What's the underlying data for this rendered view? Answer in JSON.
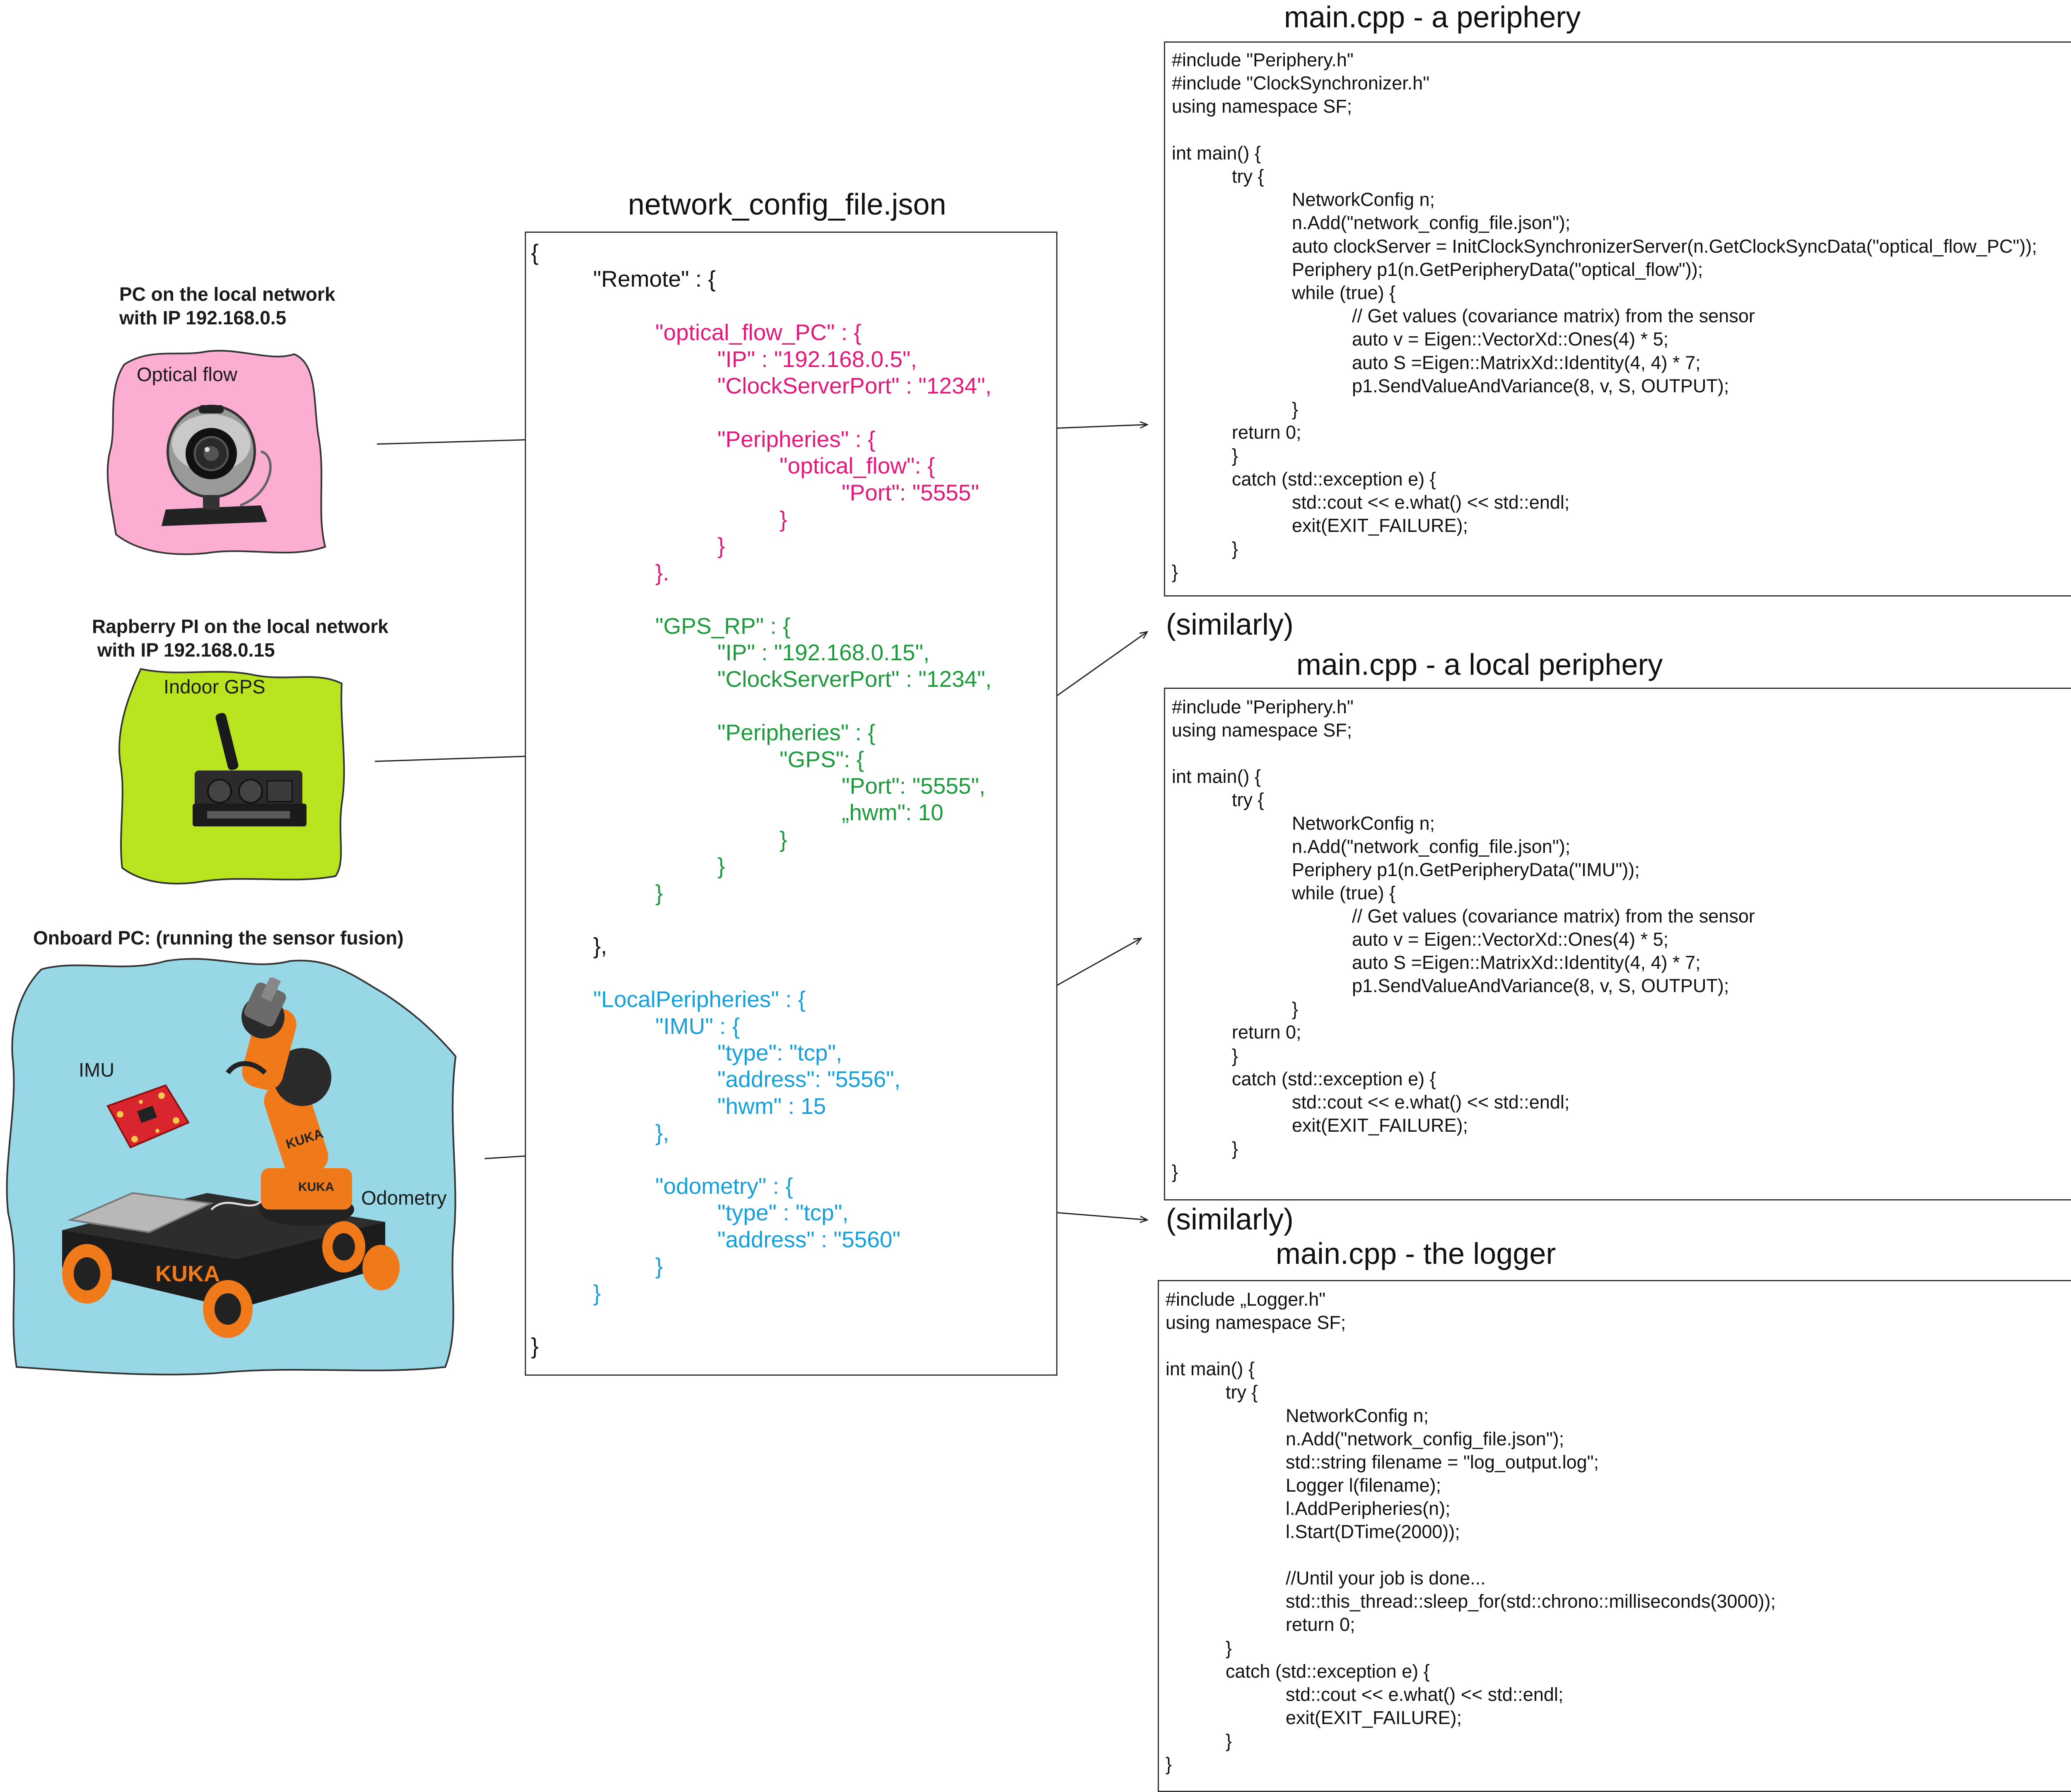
{
  "colors": {
    "pc_blob": "#fbaed2",
    "rpi_blob": "#b9e420",
    "onboard_blob": "#98d8e6",
    "json_remote": "#111111",
    "json_optical": "#e2197a",
    "json_gps": "#1d9a3c",
    "json_local": "#16a0da",
    "border": "#333333"
  },
  "nodes": [
    {
      "title_lines": [
        "PC on the local network",
        "with IP 192.168.0.5"
      ],
      "devices": [
        {
          "label": "Optical flow",
          "icon": "webcam-icon"
        }
      ]
    },
    {
      "title_lines": [
        "Rapberry PI on the local network",
        " with IP 192.168.0.15"
      ],
      "devices": [
        {
          "label": "Indoor GPS",
          "icon": "indoor-gps-beacon-icon"
        }
      ]
    },
    {
      "title_lines": [
        "Onboard PC: (running the sensor fusion)"
      ],
      "devices": [
        {
          "label": "IMU",
          "icon": "imu-board-icon"
        },
        {
          "label": "Odometry",
          "icon": "kuka-mobile-robot-icon"
        }
      ]
    }
  ],
  "json_file": {
    "title": "network_config_file.json",
    "lines": [
      {
        "indent": 0,
        "color": "json_remote",
        "text": "{"
      },
      {
        "indent": 1,
        "color": "json_remote",
        "text": "\"Remote\" : {"
      },
      {
        "indent": 0,
        "color": "json_remote",
        "text": ""
      },
      {
        "indent": 2,
        "color": "json_optical",
        "text": "\"optical_flow_PC\" : {"
      },
      {
        "indent": 3,
        "color": "json_optical",
        "text": "\"IP\" : \"192.168.0.5\","
      },
      {
        "indent": 3,
        "color": "json_optical",
        "text": "\"ClockServerPort\" : \"1234\","
      },
      {
        "indent": 0,
        "color": "json_optical",
        "text": ""
      },
      {
        "indent": 3,
        "color": "json_optical",
        "text": "\"Peripheries\" : {"
      },
      {
        "indent": 4,
        "color": "json_optical",
        "text": "\"optical_flow\": {"
      },
      {
        "indent": 5,
        "color": "json_optical",
        "text": "\"Port\": \"5555\""
      },
      {
        "indent": 4,
        "color": "json_optical",
        "text": "}"
      },
      {
        "indent": 3,
        "color": "json_optical",
        "text": "}"
      },
      {
        "indent": 2,
        "color": "json_optical",
        "text": "}."
      },
      {
        "indent": 0,
        "color": "json_gps",
        "text": ""
      },
      {
        "indent": 2,
        "color": "json_gps",
        "text": "\"GPS_RP\" : {"
      },
      {
        "indent": 3,
        "color": "json_gps",
        "text": "\"IP\" : \"192.168.0.15\","
      },
      {
        "indent": 3,
        "color": "json_gps",
        "text": "\"ClockServerPort\" : \"1234\","
      },
      {
        "indent": 0,
        "color": "json_gps",
        "text": ""
      },
      {
        "indent": 3,
        "color": "json_gps",
        "text": "\"Peripheries\" : {"
      },
      {
        "indent": 4,
        "color": "json_gps",
        "text": "\"GPS\": {"
      },
      {
        "indent": 5,
        "color": "json_gps",
        "text": "\"Port\": \"5555\","
      },
      {
        "indent": 5,
        "color": "json_gps",
        "text": "„hwm\": 10"
      },
      {
        "indent": 4,
        "color": "json_gps",
        "text": "}"
      },
      {
        "indent": 3,
        "color": "json_gps",
        "text": "}"
      },
      {
        "indent": 2,
        "color": "json_gps",
        "text": "}"
      },
      {
        "indent": 0,
        "color": "json_remote",
        "text": ""
      },
      {
        "indent": 1,
        "color": "json_remote",
        "text": "},"
      },
      {
        "indent": 0,
        "color": "json_remote",
        "text": ""
      },
      {
        "indent": 1,
        "color": "json_local",
        "text": "\"LocalPeripheries\" : {"
      },
      {
        "indent": 2,
        "color": "json_local",
        "text": "\"IMU\" : {"
      },
      {
        "indent": 3,
        "color": "json_local",
        "text": "\"type\": \"tcp\","
      },
      {
        "indent": 3,
        "color": "json_local",
        "text": "\"address\": \"5556\","
      },
      {
        "indent": 3,
        "color": "json_local",
        "text": "\"hwm\" : 15"
      },
      {
        "indent": 2,
        "color": "json_local",
        "text": "},"
      },
      {
        "indent": 0,
        "color": "json_local",
        "text": ""
      },
      {
        "indent": 2,
        "color": "json_local",
        "text": "\"odometry\" : {"
      },
      {
        "indent": 3,
        "color": "json_local",
        "text": "\"type\" : \"tcp\","
      },
      {
        "indent": 3,
        "color": "json_local",
        "text": "\"address\" : \"5560\""
      },
      {
        "indent": 2,
        "color": "json_local",
        "text": "}"
      },
      {
        "indent": 1,
        "color": "json_local",
        "text": "}"
      },
      {
        "indent": 0,
        "color": "json_remote",
        "text": ""
      },
      {
        "indent": 0,
        "color": "json_remote",
        "text": "}"
      }
    ]
  },
  "code_files": [
    {
      "title": "main.cpp - a periphery",
      "lines": [
        {
          "indent": 0,
          "text": "#include \"Periphery.h\""
        },
        {
          "indent": 0,
          "text": "#include \"ClockSynchronizer.h\""
        },
        {
          "indent": 0,
          "text": "using namespace SF;"
        },
        {
          "indent": 0,
          "text": ""
        },
        {
          "indent": 0,
          "text": "int main() {"
        },
        {
          "indent": 1,
          "text": "try {"
        },
        {
          "indent": 2,
          "text": "NetworkConfig n;"
        },
        {
          "indent": 2,
          "text": "n.Add(\"network_config_file.json\");"
        },
        {
          "indent": 2,
          "text": "auto clockServer = InitClockSynchronizerServer(n.GetClockSyncData(\"optical_flow_PC\"));"
        },
        {
          "indent": 2,
          "text": "Periphery p1(n.GetPeripheryData(\"optical_flow\"));"
        },
        {
          "indent": 2,
          "text": "while (true) {"
        },
        {
          "indent": 3,
          "text": "// Get values (covariance matrix) from the sensor"
        },
        {
          "indent": 3,
          "text": "auto v = Eigen::VectorXd::Ones(4) * 5;"
        },
        {
          "indent": 3,
          "text": "auto S =Eigen::MatrixXd::Identity(4, 4) * 7;"
        },
        {
          "indent": 3,
          "text": "p1.SendValueAndVariance(8, v, S, OUTPUT);"
        },
        {
          "indent": 2,
          "text": "}"
        },
        {
          "indent": 1,
          "text": "return 0;"
        },
        {
          "indent": 1,
          "text": "}"
        },
        {
          "indent": 1,
          "text": "catch (std::exception e) {"
        },
        {
          "indent": 2,
          "text": "std::cout << e.what() << std::endl;"
        },
        {
          "indent": 2,
          "text": "exit(EXIT_FAILURE);"
        },
        {
          "indent": 1,
          "text": "}"
        },
        {
          "indent": 0,
          "text": "}"
        }
      ]
    },
    {
      "title": "main.cpp - a local periphery",
      "lines": [
        {
          "indent": 0,
          "text": "#include \"Periphery.h\""
        },
        {
          "indent": 0,
          "text": "using namespace SF;"
        },
        {
          "indent": 0,
          "text": ""
        },
        {
          "indent": 0,
          "text": "int main() {"
        },
        {
          "indent": 1,
          "text": "try {"
        },
        {
          "indent": 2,
          "text": "NetworkConfig n;"
        },
        {
          "indent": 2,
          "text": "n.Add(\"network_config_file.json\");"
        },
        {
          "indent": 2,
          "text": "Periphery p1(n.GetPeripheryData(\"IMU\"));"
        },
        {
          "indent": 2,
          "text": "while (true) {"
        },
        {
          "indent": 3,
          "text": "// Get values (covariance matrix) from the sensor"
        },
        {
          "indent": 3,
          "text": "auto v = Eigen::VectorXd::Ones(4) * 5;"
        },
        {
          "indent": 3,
          "text": "auto S =Eigen::MatrixXd::Identity(4, 4) * 7;"
        },
        {
          "indent": 3,
          "text": "p1.SendValueAndVariance(8, v, S, OUTPUT);"
        },
        {
          "indent": 2,
          "text": "}"
        },
        {
          "indent": 1,
          "text": "return 0;"
        },
        {
          "indent": 1,
          "text": "}"
        },
        {
          "indent": 1,
          "text": "catch (std::exception e) {"
        },
        {
          "indent": 2,
          "text": "std::cout << e.what() << std::endl;"
        },
        {
          "indent": 2,
          "text": "exit(EXIT_FAILURE);"
        },
        {
          "indent": 1,
          "text": "}"
        },
        {
          "indent": 0,
          "text": "}"
        }
      ]
    },
    {
      "title": "main.cpp - the logger",
      "lines": [
        {
          "indent": 0,
          "text": "#include „Logger.h\""
        },
        {
          "indent": 0,
          "text": "using namespace SF;"
        },
        {
          "indent": 0,
          "text": ""
        },
        {
          "indent": 0,
          "text": "int main() {"
        },
        {
          "indent": 1,
          "text": "try {"
        },
        {
          "indent": 2,
          "text": "NetworkConfig n;"
        },
        {
          "indent": 2,
          "text": "n.Add(\"network_config_file.json\");"
        },
        {
          "indent": 2,
          "text": "std::string filename = \"log_output.log\";"
        },
        {
          "indent": 2,
          "text": "Logger l(filename);"
        },
        {
          "indent": 2,
          "text": "l.AddPeripheries(n);"
        },
        {
          "indent": 2,
          "text": "l.Start(DTime(2000));"
        },
        {
          "indent": 0,
          "text": ""
        },
        {
          "indent": 2,
          "text": "//Until your job is done..."
        },
        {
          "indent": 2,
          "text": "std::this_thread::sleep_for(std::chrono::milliseconds(3000));"
        },
        {
          "indent": 2,
          "text": "return 0;"
        },
        {
          "indent": 1,
          "text": "}"
        },
        {
          "indent": 1,
          "text": "catch (std::exception e) {"
        },
        {
          "indent": 2,
          "text": "std::cout << e.what() << std::endl;"
        },
        {
          "indent": 2,
          "text": "exit(EXIT_FAILURE);"
        },
        {
          "indent": 1,
          "text": "}"
        },
        {
          "indent": 0,
          "text": "}"
        }
      ]
    }
  ],
  "similarly_notes": [
    "(similarly)",
    "(similarly)"
  ]
}
